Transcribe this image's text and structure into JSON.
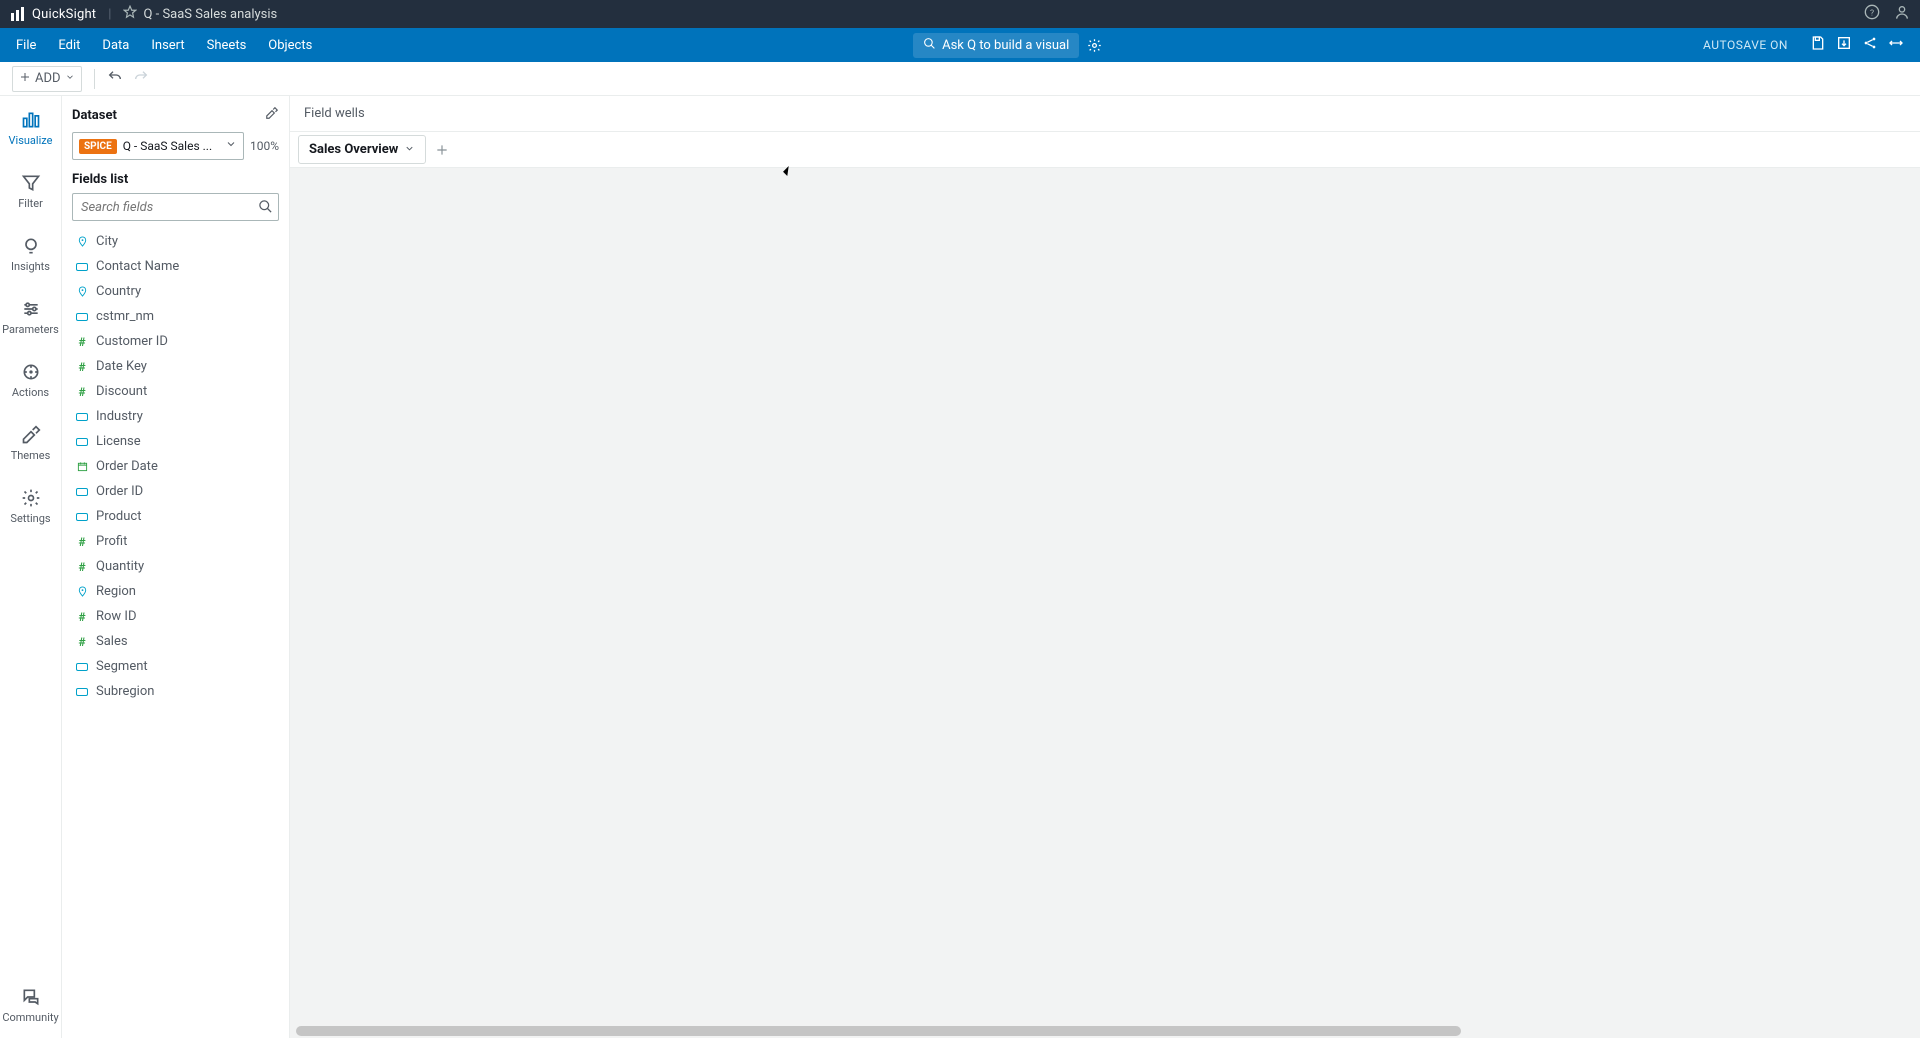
{
  "topbar": {
    "app_name": "QuickSight",
    "analysis_name": "Q - SaaS Sales analysis"
  },
  "menubar": {
    "items": [
      "File",
      "Edit",
      "Data",
      "Insert",
      "Sheets",
      "Objects"
    ],
    "ask_q": "Ask Q to build a visual",
    "autosave": "AUTOSAVE ON"
  },
  "toolbar": {
    "add_label": "ADD"
  },
  "rail": {
    "items": [
      {
        "key": "visualize",
        "label": "Visualize"
      },
      {
        "key": "filter",
        "label": "Filter"
      },
      {
        "key": "insights",
        "label": "Insights"
      },
      {
        "key": "parameters",
        "label": "Parameters"
      },
      {
        "key": "actions",
        "label": "Actions"
      },
      {
        "key": "themes",
        "label": "Themes"
      },
      {
        "key": "settings",
        "label": "Settings"
      }
    ],
    "bottom": {
      "key": "community",
      "label": "Community"
    }
  },
  "data_panel": {
    "dataset_label": "Dataset",
    "spice_badge": "SPICE",
    "dataset_name": "Q - SaaS Sales ...",
    "percent": "100%",
    "fields_label": "Fields list",
    "search_placeholder": "Search fields",
    "fields": [
      {
        "type": "geo",
        "name": "City"
      },
      {
        "type": "str",
        "name": "Contact Name"
      },
      {
        "type": "geo",
        "name": "Country"
      },
      {
        "type": "str",
        "name": "cstmr_nm"
      },
      {
        "type": "num",
        "name": "Customer ID"
      },
      {
        "type": "num",
        "name": "Date Key"
      },
      {
        "type": "num",
        "name": "Discount"
      },
      {
        "type": "str",
        "name": "Industry"
      },
      {
        "type": "str",
        "name": "License"
      },
      {
        "type": "date",
        "name": "Order Date"
      },
      {
        "type": "str",
        "name": "Order ID"
      },
      {
        "type": "str",
        "name": "Product"
      },
      {
        "type": "num",
        "name": "Profit"
      },
      {
        "type": "num",
        "name": "Quantity"
      },
      {
        "type": "geo",
        "name": "Region"
      },
      {
        "type": "num",
        "name": "Row ID"
      },
      {
        "type": "num",
        "name": "Sales"
      },
      {
        "type": "str",
        "name": "Segment"
      },
      {
        "type": "str",
        "name": "Subregion"
      }
    ]
  },
  "canvas": {
    "field_wells_label": "Field wells",
    "sheet_tab": "Sales Overview"
  }
}
